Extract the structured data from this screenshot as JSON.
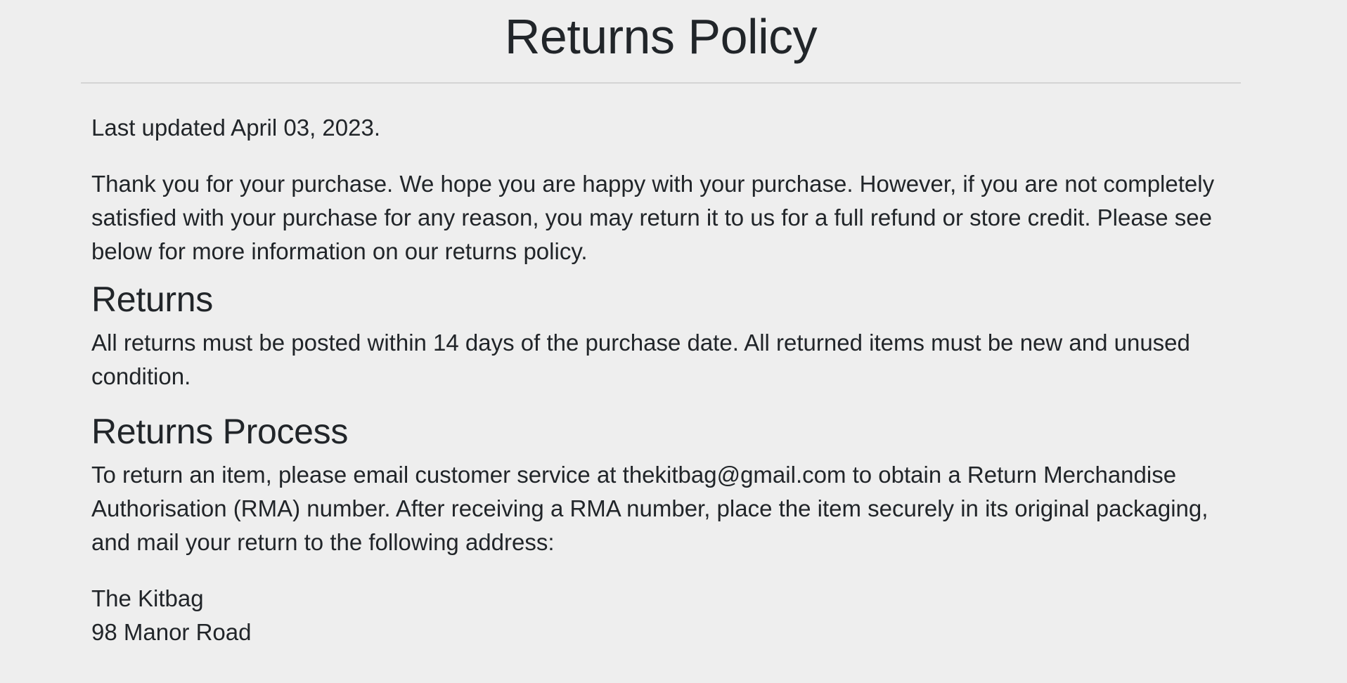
{
  "page": {
    "title": "Returns Policy",
    "last_updated": "Last updated April 03, 2023.",
    "intro": "Thank you for your purchase. We hope you are happy with your purchase. However, if you are not completely satisfied with your purchase for any reason, you may return it to us for a full refund or store credit. Please see below for more information on our returns policy."
  },
  "sections": [
    {
      "heading": "Returns",
      "body": "All returns must be posted within 14 days of the purchase date. All returned items must be new and unused condition."
    },
    {
      "heading": "Returns Process",
      "body": "To return an item, please email customer service at thekitbag@gmail.com to obtain a Return Merchandise Authorisation (RMA) number. After receiving a RMA number, place the item securely in its original packaging, and mail your return to the following address:"
    }
  ],
  "address": {
    "line1": "The Kitbag",
    "line2": "98 Manor Road"
  },
  "colors": {
    "background": "#eeeeee",
    "text": "#212529",
    "divider": "#d4d4d4"
  }
}
